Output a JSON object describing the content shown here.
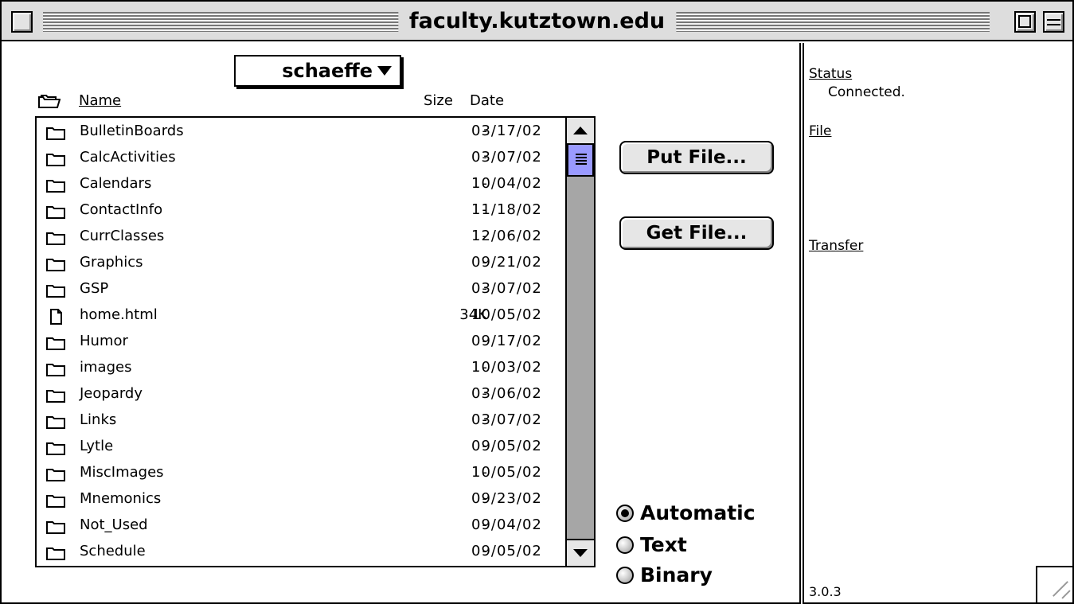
{
  "window": {
    "title": "faculty.kutztown.edu"
  },
  "directory": {
    "current": "schaeffe"
  },
  "columns": {
    "name": "Name",
    "size": "Size",
    "date": "Date"
  },
  "files": [
    {
      "name": "BulletinBoards",
      "size": "-",
      "date": "03/17/02",
      "kind": "folder-icon"
    },
    {
      "name": "CalcActivities",
      "size": "-",
      "date": "03/07/02",
      "kind": "folder-icon"
    },
    {
      "name": "Calendars",
      "size": "-",
      "date": "10/04/02",
      "kind": "folder-icon"
    },
    {
      "name": "ContactInfo",
      "size": "-",
      "date": "11/18/02",
      "kind": "folder-icon"
    },
    {
      "name": "CurrClasses",
      "size": "-",
      "date": "12/06/02",
      "kind": "folder-icon"
    },
    {
      "name": "Graphics",
      "size": "-",
      "date": "09/21/02",
      "kind": "folder-icon"
    },
    {
      "name": "GSP",
      "size": "-",
      "date": "03/07/02",
      "kind": "folder-icon"
    },
    {
      "name": "home.html",
      "size": "34K",
      "date": "10/05/02",
      "kind": "document-icon"
    },
    {
      "name": "Humor",
      "size": "-",
      "date": "09/17/02",
      "kind": "folder-icon"
    },
    {
      "name": "images",
      "size": "-",
      "date": "10/03/02",
      "kind": "folder-icon"
    },
    {
      "name": "Jeopardy",
      "size": "-",
      "date": "03/06/02",
      "kind": "folder-icon"
    },
    {
      "name": "Links",
      "size": "-",
      "date": "03/07/02",
      "kind": "folder-icon"
    },
    {
      "name": "Lytle",
      "size": "-",
      "date": "09/05/02",
      "kind": "folder-icon"
    },
    {
      "name": "MiscImages",
      "size": "-",
      "date": "10/05/02",
      "kind": "folder-icon"
    },
    {
      "name": "Mnemonics",
      "size": "-",
      "date": "09/23/02",
      "kind": "folder-icon"
    },
    {
      "name": "Not_Used",
      "size": "-",
      "date": "09/04/02",
      "kind": "folder-icon"
    },
    {
      "name": "Schedule",
      "size": "-",
      "date": "09/05/02",
      "kind": "folder-icon"
    }
  ],
  "buttons": {
    "put_file": "Put File...",
    "get_file": "Get File..."
  },
  "transfer_mode": {
    "options": [
      "Automatic",
      "Text",
      "Binary"
    ],
    "selected": "Automatic"
  },
  "status_panel": {
    "status_label": "Status",
    "status_value": "Connected.",
    "file_label": "File",
    "transfer_label": "Transfer",
    "version": "3.0.3"
  },
  "colors": {
    "scroll_thumb": "#9a9aff",
    "scroll_track": "#a6a6a6",
    "chrome": "#dddddd"
  }
}
